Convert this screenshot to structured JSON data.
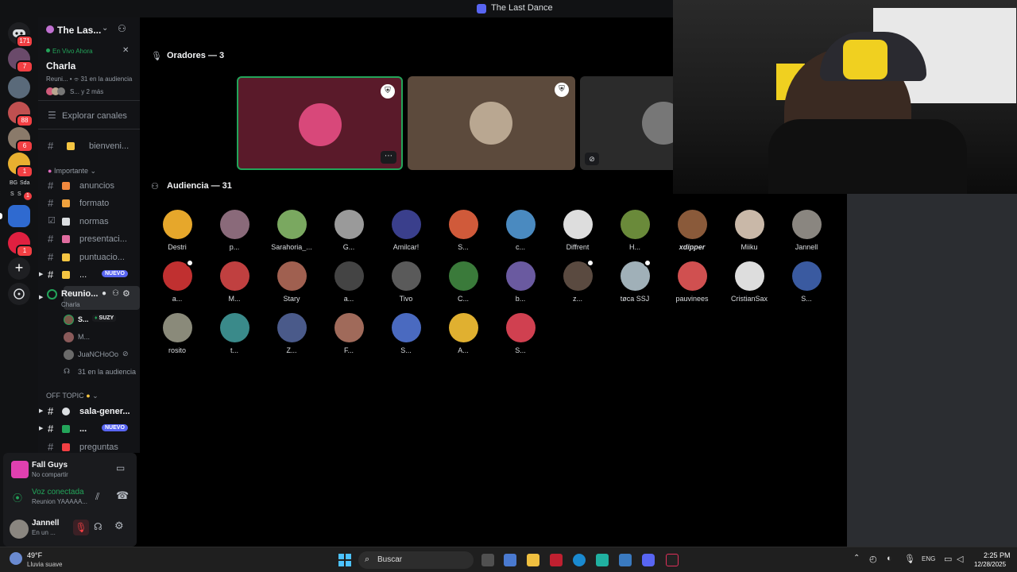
{
  "window": {
    "title": "The Last Dance"
  },
  "rail": {
    "servers": [
      {
        "badge": "171"
      },
      {
        "badge": "7"
      },
      {
        "badge": ""
      },
      {
        "badge": "88"
      },
      {
        "badge": "6"
      },
      {
        "badge": "1"
      },
      {
        "label": "BG",
        "label2": "Sda",
        "label3": "S",
        "label4": "S",
        "badge": "1"
      },
      {
        "badge": ""
      },
      {
        "badge": "1"
      }
    ]
  },
  "sidebar": {
    "server_name": "The Las...",
    "live_label": "En Vivo Ahora",
    "stage_title": "Charla",
    "stage_meta": "Reuni... • ⌯ 31 en la audiencia",
    "stage_people": "S... y 2 más",
    "explore": "Explorar canales",
    "channels": [
      {
        "label": "bienveni...",
        "color": "#f5c542"
      },
      {
        "category": "Importante"
      },
      {
        "label": "anuncios",
        "color": "#f0883e"
      },
      {
        "label": "formato",
        "color": "#f0a23e"
      },
      {
        "label": "normas",
        "color": "#dbdee1"
      },
      {
        "label": "presentaci...",
        "color": "#e06c9f"
      },
      {
        "label": "puntuacio...",
        "color": "#f5c542"
      },
      {
        "label": "...",
        "color": "#f5c542",
        "badge": "NUEVO"
      }
    ],
    "voice_channel": {
      "label": "Reunio...",
      "sub": "Charla"
    },
    "voice_members": [
      {
        "name": "S...",
        "tag": "SUZY"
      },
      {
        "name": "M..."
      },
      {
        "name": "JuaNCHoOo"
      }
    ],
    "audience_count": "31 en la audiencia",
    "off_topic": "OFF TOPIC",
    "lower_channels": [
      {
        "label": "sala-gener...",
        "bold": true
      },
      {
        "label": "...",
        "badge": "NUEVO",
        "bold": true
      },
      {
        "label": "preguntas"
      }
    ]
  },
  "userpanel": {
    "activity_name": "Fall Guys",
    "activity_sub": "No compartir",
    "voice_status": "Voz conectada",
    "voice_channel": "Reunion YAAAAA...",
    "user_name": "Jannell",
    "user_status": "En un ..."
  },
  "main": {
    "speakers_header": "Oradores — 3",
    "audience_header": "Audiencia — 31",
    "speakers": [
      {
        "bg": "#5a1a2a",
        "avatar": "#d8487a"
      },
      {
        "bg": "#5c4a3c",
        "avatar": "#b9a791"
      },
      {
        "bg": "#2b2b2b",
        "avatar": "#777777"
      }
    ],
    "audience": [
      {
        "name": "Destri",
        "color": "#e6a72b"
      },
      {
        "name": "p...",
        "color": "#8a6a7a"
      },
      {
        "name": "Sarahoria_...",
        "color": "#7aa860"
      },
      {
        "name": "G...",
        "color": "#9a9a9a"
      },
      {
        "name": "Amilcar!",
        "color": "#3a3f8c"
      },
      {
        "name": "S...",
        "color": "#d05a3a"
      },
      {
        "name": "c...",
        "color": "#4a8ac0"
      },
      {
        "name": "Diffrent",
        "color": "#dddddd"
      },
      {
        "name": "H...",
        "color": "#6a8a3a"
      },
      {
        "name": "xdipper",
        "color": "#8a5a3a"
      },
      {
        "name": "Miiku",
        "color": "#c9b8a8"
      },
      {
        "name": "Jannell",
        "color": "#8a8680"
      },
      {
        "name": "a...",
        "color": "#c03030"
      },
      {
        "name": "M...",
        "color": "#c04040"
      },
      {
        "name": "Stary",
        "color": "#a06050"
      },
      {
        "name": "a...",
        "color": "#444444"
      },
      {
        "name": "Tivo",
        "color": "#5a5a5a"
      },
      {
        "name": "C...",
        "color": "#3a7a3a"
      },
      {
        "name": "b...",
        "color": "#6a5aa0"
      },
      {
        "name": "z...",
        "color": "#5a4a40"
      },
      {
        "name": "tøca SSJ",
        "color": "#a0b0b8"
      },
      {
        "name": "pauvinees",
        "color": "#d05050"
      },
      {
        "name": "CristianSax",
        "color": "#dddddd"
      },
      {
        "name": "S...",
        "color": "#3a5aa0"
      },
      {
        "name": "rosito",
        "color": "#8a8a7a"
      },
      {
        "name": "t...",
        "color": "#3a8a8a"
      },
      {
        "name": "Z...",
        "color": "#4a5a8a"
      },
      {
        "name": "F...",
        "color": "#a06a5a"
      },
      {
        "name": "S...",
        "color": "#4a6ac0"
      },
      {
        "name": "A...",
        "color": "#e0b030"
      },
      {
        "name": "S...",
        "color": "#d04050"
      }
    ]
  },
  "taskbar": {
    "weather_temp": "49°F",
    "weather_desc": "Lluvia suave",
    "search": "Buscar",
    "lang": "ENG",
    "time": "2:25 PM",
    "date": "12/28/2025"
  },
  "colors": {
    "green": "#23a55a",
    "blurple": "#5865f2",
    "red": "#f23f43"
  }
}
